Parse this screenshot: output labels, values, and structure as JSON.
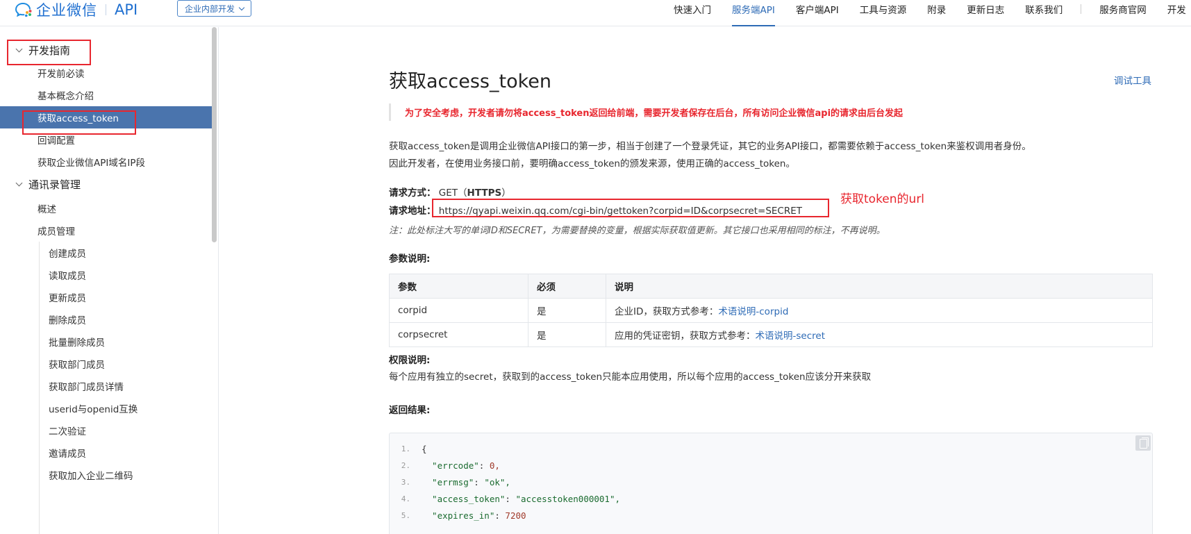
{
  "header": {
    "logo_text": "企业微信",
    "logo_api": "API",
    "scope_label": "企业内部开发",
    "nav": [
      {
        "label": "快速入门"
      },
      {
        "label": "服务端API"
      },
      {
        "label": "客户端API"
      },
      {
        "label": "工具与资源"
      },
      {
        "label": "附录"
      },
      {
        "label": "更新日志"
      },
      {
        "label": "联系我们"
      },
      {
        "label": "服务商官网"
      },
      {
        "label": "开发"
      }
    ]
  },
  "sidebar": {
    "group1": "开发指南",
    "group1_items": [
      "开发前必读",
      "基本概念介绍",
      "获取access_token",
      "回调配置",
      "获取企业微信API域名IP段"
    ],
    "group2": "通讯录管理",
    "group2_items": [
      "概述",
      "成员管理"
    ],
    "member_items": [
      "创建成员",
      "读取成员",
      "更新成员",
      "删除成员",
      "批量删除成员",
      "获取部门成员",
      "获取部门成员详情",
      "userid与openid互换",
      "二次验证",
      "邀请成员",
      "获取加入企业二维码"
    ]
  },
  "main": {
    "title": "获取access_token",
    "debug_link": "调试工具",
    "warning": "为了安全考虑，开发者请勿将access_token返回给前端，需要开发者保存在后台，所有访问企业微信api的请求由后台发起",
    "intro1": "获取access_token是调用企业微信API接口的第一步，相当于创建了一个登录凭证，其它的业务API接口，都需要依赖于access_token来鉴权调用者身份。",
    "intro2": "因此开发者，在使用业务接口前，要明确access_token的颁发来源，使用正确的access_token。",
    "method_label": "请求方式：",
    "method_value": "GET（",
    "method_https": "HTTPS",
    "method_close": "）",
    "url_label": "请求地址：",
    "url_value": "https://qyapi.weixin.qq.com/cgi-bin/gettoken?corpid=ID&corpsecret=SECRET",
    "note": "注：此处标注大写的单词ID和SECRET，为需要替换的变量，根据实际获取值更新。其它接口也采用相同的标注，不再说明。",
    "params_title": "参数说明:",
    "table_headers": [
      "参数",
      "必须",
      "说明"
    ],
    "table_rows": [
      {
        "param": "corpid",
        "required": "是",
        "desc": "企业ID，获取方式参考：",
        "link": "术语说明-corpid"
      },
      {
        "param": "corpsecret",
        "required": "是",
        "desc": "应用的凭证密钥，获取方式参考：",
        "link": "术语说明-secret"
      }
    ],
    "perm_title": "权限说明:",
    "perm_text": "每个应用有独立的secret，获取到的access_token只能本应用使用，所以每个应用的access_token应该分开来获取",
    "result_title": "返回结果:",
    "code_lines": [
      {
        "n": "1.",
        "key": "{",
        "val": ""
      },
      {
        "n": "2.",
        "key": "  \"errcode\"",
        "val": "0,"
      },
      {
        "n": "3.",
        "key": "  \"errmsg\"",
        "val": "\"ok\","
      },
      {
        "n": "4.",
        "key": "  \"access_token\"",
        "val": "\"accesstoken000001\","
      },
      {
        "n": "5.",
        "key": "  \"expires_in\"",
        "val": "7200"
      }
    ]
  },
  "annotation": {
    "url_note": "获取token的url"
  },
  "colors": {
    "accent": "#2e6bb6",
    "active_bg": "#4a74ad",
    "annotation": "#e8262e"
  }
}
